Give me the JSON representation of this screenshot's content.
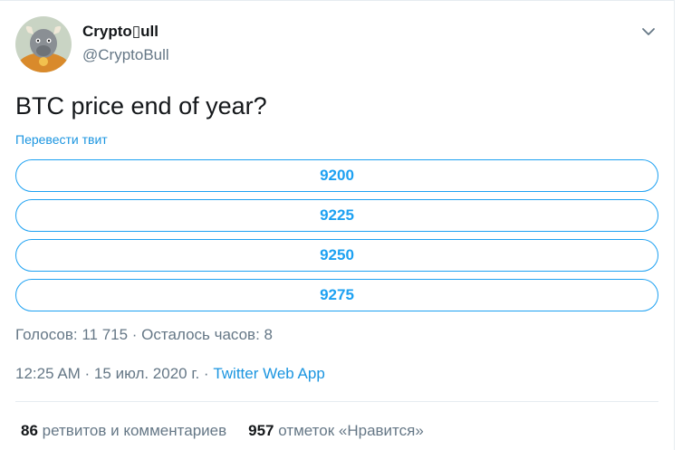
{
  "tweet": {
    "author_name": "Crypto▯ull",
    "author_handle": "@CryptoBull",
    "avatar_icon": "bull-avatar-icon",
    "menu_icon": "chevron-down-icon",
    "text": "BTC price end of year?",
    "translate_label": "Перевести твит",
    "poll": {
      "options": [
        "9200",
        "9225",
        "9250",
        "9275"
      ],
      "summary": "Голосов: 11 715 · Осталось часов: 8"
    },
    "time": "12:25 AM · 15 июл. 2020 г. · ",
    "source": "Twitter Web App",
    "stats": {
      "retweets_count": "86",
      "retweets_label": "ретвитов и комментариев",
      "likes_count": "957",
      "likes_label": "отметок «Нравится»"
    }
  },
  "colors": {
    "accent": "#1da1f2",
    "link": "#1b95e0",
    "secondary_text": "#657786",
    "primary_text": "#14171a"
  }
}
